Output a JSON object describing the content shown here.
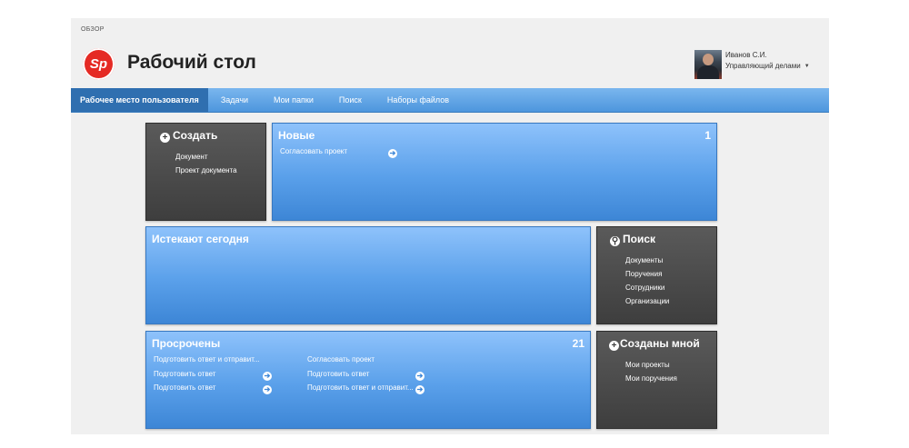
{
  "breadcrumb": "ОБЗОР",
  "logo_text": "Sp",
  "page_title": "Рабочий стол",
  "user": {
    "name": "Иванов С.И.",
    "role": "Управляющий делами",
    "caret": "▼"
  },
  "nav": {
    "tabs": [
      "Рабочее место пользователя",
      "Задачи",
      "Мои папки",
      "Поиск",
      "Наборы файлов"
    ]
  },
  "create": {
    "title": "Создать",
    "icon": "plus-icon",
    "items": [
      "Документ",
      "Проект документа"
    ]
  },
  "new": {
    "title": "Новые",
    "count": "1",
    "items": [
      "Согласовать проект"
    ]
  },
  "today": {
    "title": "Истекают сегодня"
  },
  "search": {
    "title": "Поиск",
    "icon": "search-icon",
    "items": [
      "Документы",
      "Поручения",
      "Сотрудники",
      "Организации"
    ]
  },
  "overdue": {
    "title": "Просрочены",
    "count": "21",
    "col1": [
      "Подготовить ответ и отправит...",
      "Подготовить ответ",
      "Подготовить ответ"
    ],
    "col2": [
      "Согласовать проект",
      "Подготовить ответ",
      "Подготовить ответ и отправит..."
    ]
  },
  "mine": {
    "title": "Созданы мной",
    "icon": "plus-icon",
    "items": [
      "Мои проекты",
      "Мои поручения"
    ]
  },
  "icons": {
    "arrow": "➔",
    "plus": "+",
    "search": "⚲"
  },
  "colors": {
    "nav": "#4d96dd",
    "tile_blue": "#5aa0ea",
    "tile_dark": "#4a4a4a",
    "logo": "#e52a24"
  }
}
